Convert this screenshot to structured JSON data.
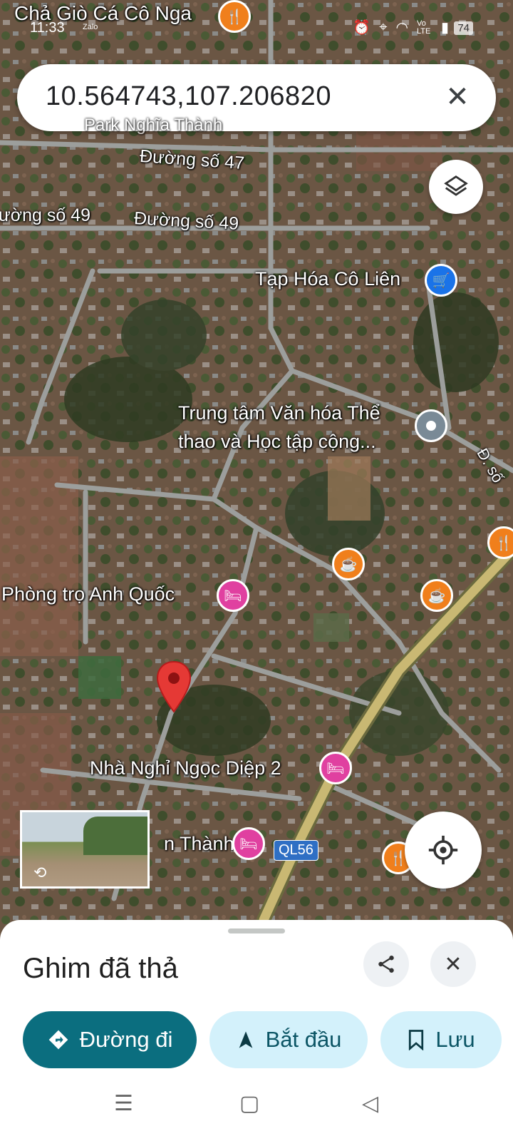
{
  "status_bar": {
    "time": "11:33",
    "app": "Zalo",
    "network": "Vo LTE",
    "battery": "74"
  },
  "search": {
    "query": "10.564743,107.206820"
  },
  "map_labels": {
    "top_place": "Chả Giò Cá Cô Nga",
    "park": "Park Nghĩa Thành",
    "road_47": "Đường số 47",
    "road_49_left": "ường số 49",
    "road_49": "Đường số 49",
    "store": "Tạp Hóa Cô Liên",
    "center_line1": "Trung tâm Văn hóa Thể",
    "center_line2": "thao và Học tập cộng...",
    "road_edge": "Đ. số",
    "hostel": "Phòng trọ Anh Quốc",
    "motel": "Nhà Nghỉ Ngọc Diệp 2",
    "partial_place": "n Thành",
    "highway": "QL56"
  },
  "sheet": {
    "title": "Ghim đã thả",
    "directions_label": "Đường đi",
    "start_label": "Bắt đầu",
    "save_label": "Lưu"
  },
  "colors": {
    "primary": "#0b6e7f",
    "accent_light": "#d3f1fb",
    "pin_red": "#e53935",
    "hotel_pink": "#e040a0",
    "cafe_orange": "#f07f1c"
  }
}
